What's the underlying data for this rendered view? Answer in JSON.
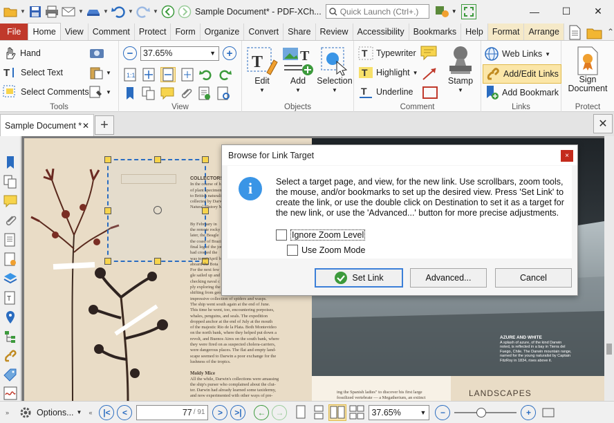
{
  "titlebar": {
    "document_title": "Sample Document* - PDF-XCh...",
    "quick_launch_placeholder": "Quick Launch (Ctrl+.)"
  },
  "ribbon_tabs": [
    "File",
    "Home",
    "View",
    "Comment",
    "Protect",
    "Form",
    "Organize",
    "Convert",
    "Share",
    "Review",
    "Accessibility",
    "Bookmarks",
    "Help",
    "Format",
    "Arrange"
  ],
  "active_tab": "Home",
  "groups": {
    "tools": {
      "label": "Tools",
      "hand": "Hand",
      "select_text": "Select Text",
      "select_comments": "Select Comments"
    },
    "view": {
      "label": "View",
      "zoom": "37.65%"
    },
    "objects": {
      "label": "Objects",
      "edit": "Edit",
      "add": "Add",
      "selection": "Selection"
    },
    "comment": {
      "label": "Comment",
      "typewriter": "Typewriter",
      "highlight": "Highlight",
      "underline": "Underline",
      "stamp": "Stamp"
    },
    "links": {
      "label": "Links",
      "web_links": "Web Links",
      "add_edit_links": "Add/Edit Links",
      "add_bookmark": "Add Bookmark"
    },
    "protect": {
      "label": "Protect",
      "sign_document_1": "Sign",
      "sign_document_2": "Document"
    }
  },
  "doc_tab": {
    "label": "Sample Document *"
  },
  "document": {
    "heading": "COLLECTORS",
    "col_lines": [
      "In the course of his",
      "of plant specimens",
      "to British naturalists",
      "collected by Darwin",
      "Natural History Mu"
    ],
    "body_text": [
      "By February in",
      "the remote rocky",
      "later, the Beagle",
      "the coast of Brazil",
      "final leg of the jou",
      "had crossed the",
      "was to set April b",
      "aboard the Bota",
      "For the next few",
      "gle sailed up and",
      "checking naval c",
      "ply exploring the",
      "shifting from geology to zoology, and creating an",
      "impressive collection of spiders and wasps.",
      "The ship went south again at the end of June.",
      "This time he went, too, encountering porpoises,",
      "whales, penguins, and seals. The expedition",
      "dropped anchor at the end of July at the mouth",
      "of the majestic Rio de la Plata. Both Montevideo",
      "on the north bank, where they helped put down a",
      "revolt, and Buenos Aires on the south bank, where",
      "they were fired on as suspected cholera-carriers,",
      "were dangerous places. The flat and empty land-",
      "scape seemed to Darwin a poor exchange for the",
      "lushness of the tropics."
    ],
    "subheading": "Moldy Mice",
    "subtext": [
      "All the while, Darwin's collections were amassing",
      "the ship's purser who complained about the clut-",
      "ter. Darwin had already learned some taxidermy,",
      "and now experimented with other ways of pre-"
    ],
    "right_caption_title": "AZURE AND WHITE",
    "right_caption": [
      "A splash of azure, of the kind Darwin",
      "noted, is reflected in a bay in Tierra del",
      "Fuego, Chile. The Darwin mountain range,",
      "named for the young naturalist by Captain",
      "FitzRoy in 1834, rises above it."
    ],
    "right_bottom_text": [
      "ing the Spanish ladies\" to discover his first large",
      "fossilized vertebrate — a Megatherium, an extinct"
    ],
    "landscapes": "LANDSCAPES"
  },
  "dialog": {
    "title": "Browse for Link Target",
    "close_label": "×",
    "message": "Select a target page, and view, for the new link. Use scrollbars, zoom tools, the mouse, and/or bookmarks to set up the desired view. Press 'Set Link' to create the link, or use the double click on Destination to set it as a target for the new link, or use the 'Advanced...' button for more precise adjustments.",
    "ignore_zoom": "Ignore Zoom Level",
    "use_zoom_mode": "Use Zoom Mode",
    "set_link": "Set Link",
    "advanced": "Advanced...",
    "cancel": "Cancel"
  },
  "statusbar": {
    "options": "Options...",
    "current_page": "77",
    "total_pages": "/ 91",
    "zoom": "37.65%"
  },
  "colors": {
    "file_tab": "#c0392b",
    "accent_blue": "#2a6cc0",
    "dialog_close": "#c42b1c",
    "link_highlight": "#fbe6a8"
  }
}
